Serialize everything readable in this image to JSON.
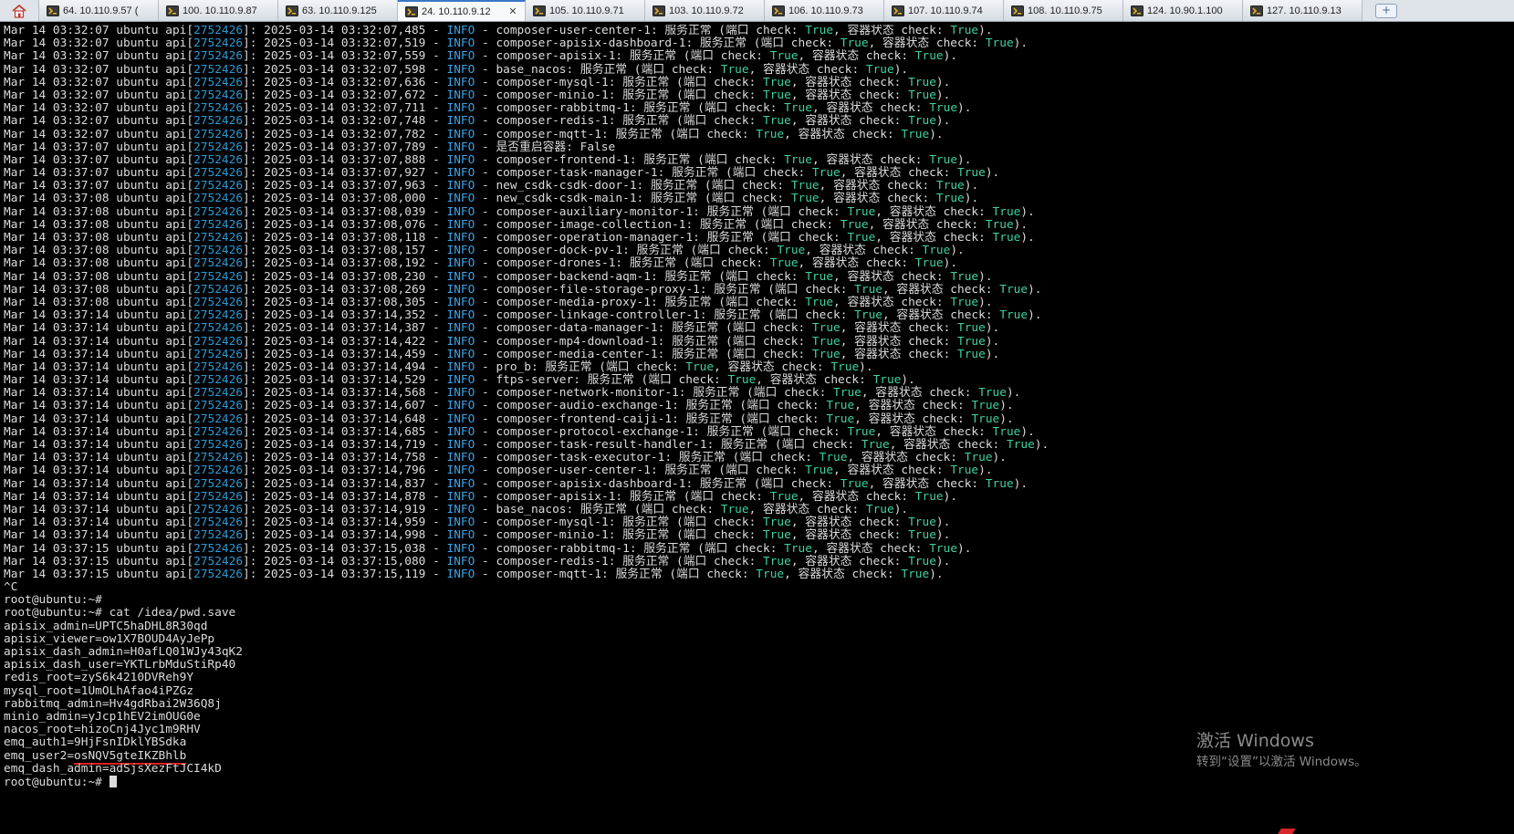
{
  "tabs": [
    {
      "label": "64. 10.110.9.57 (",
      "active": false
    },
    {
      "label": "100. 10.110.9.87",
      "active": false
    },
    {
      "label": "63. 10.110.9.125",
      "active": false
    },
    {
      "label": "24. 10.110.9.12",
      "active": true
    },
    {
      "label": "105. 10.110.9.71",
      "active": false
    },
    {
      "label": "103. 10.110.9.72",
      "active": false
    },
    {
      "label": "106. 10.110.9.73",
      "active": false
    },
    {
      "label": "107. 10.110.9.74",
      "active": false
    },
    {
      "label": "108. 10.110.9.75",
      "active": false
    },
    {
      "label": "124. 10.90.1.100",
      "active": false
    },
    {
      "label": "127. 10.110.9.13",
      "active": false
    }
  ],
  "log_lines": [
    {
      "ts": "Mar 14 03:32:07",
      "dt": "2025-03-14 03:32:07,485",
      "msg": "composer-user-center-1",
      "p": "True",
      "c": "True"
    },
    {
      "ts": "Mar 14 03:32:07",
      "dt": "2025-03-14 03:32:07,519",
      "msg": "composer-apisix-dashboard-1",
      "p": "True",
      "c": "True"
    },
    {
      "ts": "Mar 14 03:32:07",
      "dt": "2025-03-14 03:32:07,559",
      "msg": "composer-apisix-1",
      "p": "True",
      "c": "True"
    },
    {
      "ts": "Mar 14 03:32:07",
      "dt": "2025-03-14 03:32:07,598",
      "msg": "base_nacos",
      "p": "True",
      "c": "True"
    },
    {
      "ts": "Mar 14 03:32:07",
      "dt": "2025-03-14 03:32:07,636",
      "msg": "composer-mysql-1",
      "p": "True",
      "c": "True"
    },
    {
      "ts": "Mar 14 03:32:07",
      "dt": "2025-03-14 03:32:07,672",
      "msg": "composer-minio-1",
      "p": "True",
      "c": "True"
    },
    {
      "ts": "Mar 14 03:32:07",
      "dt": "2025-03-14 03:32:07,711",
      "msg": "composer-rabbitmq-1",
      "p": "True",
      "c": "True"
    },
    {
      "ts": "Mar 14 03:32:07",
      "dt": "2025-03-14 03:32:07,748",
      "msg": "composer-redis-1",
      "p": "True",
      "c": "True"
    },
    {
      "ts": "Mar 14 03:32:07",
      "dt": "2025-03-14 03:32:07,782",
      "msg": "composer-mqtt-1",
      "p": "True",
      "c": "True"
    },
    {
      "ts": "Mar 14 03:37:07",
      "dt": "2025-03-14 03:37:07,789",
      "msg": "是否重启容器: False",
      "p": "",
      "c": ""
    },
    {
      "ts": "Mar 14 03:37:07",
      "dt": "2025-03-14 03:37:07,888",
      "msg": "composer-frontend-1",
      "p": "True",
      "c": "True"
    },
    {
      "ts": "Mar 14 03:37:07",
      "dt": "2025-03-14 03:37:07,927",
      "msg": "composer-task-manager-1",
      "p": "True",
      "c": "True"
    },
    {
      "ts": "Mar 14 03:37:07",
      "dt": "2025-03-14 03:37:07,963",
      "msg": "new_csdk-csdk-door-1",
      "p": "True",
      "c": "True"
    },
    {
      "ts": "Mar 14 03:37:08",
      "dt": "2025-03-14 03:37:08,000",
      "msg": "new_csdk-csdk-main-1",
      "p": "True",
      "c": "True"
    },
    {
      "ts": "Mar 14 03:37:08",
      "dt": "2025-03-14 03:37:08,039",
      "msg": "composer-auxiliary-monitor-1",
      "p": "True",
      "c": "True"
    },
    {
      "ts": "Mar 14 03:37:08",
      "dt": "2025-03-14 03:37:08,076",
      "msg": "composer-image-collection-1",
      "p": "True",
      "c": "True"
    },
    {
      "ts": "Mar 14 03:37:08",
      "dt": "2025-03-14 03:37:08,118",
      "msg": "composer-operation-manager-1",
      "p": "True",
      "c": "True"
    },
    {
      "ts": "Mar 14 03:37:08",
      "dt": "2025-03-14 03:37:08,157",
      "msg": "composer-dock-pv-1",
      "p": "True",
      "c": "True"
    },
    {
      "ts": "Mar 14 03:37:08",
      "dt": "2025-03-14 03:37:08,192",
      "msg": "composer-drones-1",
      "p": "True",
      "c": "True"
    },
    {
      "ts": "Mar 14 03:37:08",
      "dt": "2025-03-14 03:37:08,230",
      "msg": "composer-backend-aqm-1",
      "p": "True",
      "c": "True"
    },
    {
      "ts": "Mar 14 03:37:08",
      "dt": "2025-03-14 03:37:08,269",
      "msg": "composer-file-storage-proxy-1",
      "p": "True",
      "c": "True"
    },
    {
      "ts": "Mar 14 03:37:08",
      "dt": "2025-03-14 03:37:08,305",
      "msg": "composer-media-proxy-1",
      "p": "True",
      "c": "True"
    },
    {
      "ts": "Mar 14 03:37:14",
      "dt": "2025-03-14 03:37:14,352",
      "msg": "composer-linkage-controller-1",
      "p": "True",
      "c": "True"
    },
    {
      "ts": "Mar 14 03:37:14",
      "dt": "2025-03-14 03:37:14,387",
      "msg": "composer-data-manager-1",
      "p": "True",
      "c": "True"
    },
    {
      "ts": "Mar 14 03:37:14",
      "dt": "2025-03-14 03:37:14,422",
      "msg": "composer-mp4-download-1",
      "p": "True",
      "c": "True"
    },
    {
      "ts": "Mar 14 03:37:14",
      "dt": "2025-03-14 03:37:14,459",
      "msg": "composer-media-center-1",
      "p": "True",
      "c": "True"
    },
    {
      "ts": "Mar 14 03:37:14",
      "dt": "2025-03-14 03:37:14,494",
      "msg": "pro_b",
      "p": "True",
      "c": "True"
    },
    {
      "ts": "Mar 14 03:37:14",
      "dt": "2025-03-14 03:37:14,529",
      "msg": "ftps-server",
      "p": "True",
      "c": "True"
    },
    {
      "ts": "Mar 14 03:37:14",
      "dt": "2025-03-14 03:37:14,568",
      "msg": "composer-network-monitor-1",
      "p": "True",
      "c": "True"
    },
    {
      "ts": "Mar 14 03:37:14",
      "dt": "2025-03-14 03:37:14,607",
      "msg": "composer-audio-exchange-1",
      "p": "True",
      "c": "True"
    },
    {
      "ts": "Mar 14 03:37:14",
      "dt": "2025-03-14 03:37:14,648",
      "msg": "composer-frontend-caiji-1",
      "p": "True",
      "c": "True"
    },
    {
      "ts": "Mar 14 03:37:14",
      "dt": "2025-03-14 03:37:14,685",
      "msg": "composer-protocol-exchange-1",
      "p": "True",
      "c": "True"
    },
    {
      "ts": "Mar 14 03:37:14",
      "dt": "2025-03-14 03:37:14,719",
      "msg": "composer-task-result-handler-1",
      "p": "True",
      "c": "True"
    },
    {
      "ts": "Mar 14 03:37:14",
      "dt": "2025-03-14 03:37:14,758",
      "msg": "composer-task-executor-1",
      "p": "True",
      "c": "True"
    },
    {
      "ts": "Mar 14 03:37:14",
      "dt": "2025-03-14 03:37:14,796",
      "msg": "composer-user-center-1",
      "p": "True",
      "c": "True"
    },
    {
      "ts": "Mar 14 03:37:14",
      "dt": "2025-03-14 03:37:14,837",
      "msg": "composer-apisix-dashboard-1",
      "p": "True",
      "c": "True"
    },
    {
      "ts": "Mar 14 03:37:14",
      "dt": "2025-03-14 03:37:14,878",
      "msg": "composer-apisix-1",
      "p": "True",
      "c": "True"
    },
    {
      "ts": "Mar 14 03:37:14",
      "dt": "2025-03-14 03:37:14,919",
      "msg": "base_nacos",
      "p": "True",
      "c": "True"
    },
    {
      "ts": "Mar 14 03:37:14",
      "dt": "2025-03-14 03:37:14,959",
      "msg": "composer-mysql-1",
      "p": "True",
      "c": "True"
    },
    {
      "ts": "Mar 14 03:37:14",
      "dt": "2025-03-14 03:37:14,998",
      "msg": "composer-minio-1",
      "p": "True",
      "c": "True"
    },
    {
      "ts": "Mar 14 03:37:15",
      "dt": "2025-03-14 03:37:15,038",
      "msg": "composer-rabbitmq-1",
      "p": "True",
      "c": "True"
    },
    {
      "ts": "Mar 14 03:37:15",
      "dt": "2025-03-14 03:37:15,080",
      "msg": "composer-redis-1",
      "p": "True",
      "c": "True"
    },
    {
      "ts": "Mar 14 03:37:15",
      "dt": "2025-03-14 03:37:15,119",
      "msg": "composer-mqtt-1",
      "p": "True",
      "c": "True"
    }
  ],
  "log_parts": {
    "host": "ubuntu",
    "proc": "api",
    "pid": "2752426",
    "level": "INFO",
    "status": "服务正常",
    "port_check": "端口 check",
    "container_check": "容器状态 check"
  },
  "shell_lines": [
    {
      "text": "^C",
      "kind": "plain"
    },
    {
      "text": "root@ubuntu:~#",
      "kind": "plain"
    },
    {
      "text": "root@ubuntu:~# cat /idea/pwd.save",
      "kind": "plain"
    },
    {
      "text": "apisix_admin=UPTC5haDHL8R30qd",
      "kind": "plain"
    },
    {
      "text": "apisix_viewer=ow1X7BOUD4AyJePp",
      "kind": "plain"
    },
    {
      "text": "apisix_dash_admin=H0afLQ01WJy43qK2",
      "kind": "plain"
    },
    {
      "text": "apisix_dash_user=YKTLrbMduStiRp40",
      "kind": "plain"
    },
    {
      "text": "redis_root=zyS6k4210DVReh9Y",
      "kind": "plain"
    },
    {
      "text": "mysql_root=1UmOLhAfao4iPZGz",
      "kind": "plain"
    },
    {
      "text": "rabbitmq_admin=Hv4gdRbai2W36Q8j",
      "kind": "plain"
    },
    {
      "text": "minio_admin=yJcp1hEV2imOUG0e",
      "kind": "plain"
    },
    {
      "text": "nacos_root=hizoCnj4Jyc1m9RHV",
      "kind": "plain"
    },
    {
      "text": "emq_auth1=9HjFsnIDklYBSdka",
      "kind": "plain"
    },
    {
      "text": "emq_user2=osNQV5gteIKZBhlb",
      "kind": "highlight"
    },
    {
      "text": "emq_dash_admin=adSjsXezFtJCI4kD",
      "kind": "plain"
    },
    {
      "text": "root@ubuntu:~#",
      "kind": "prompt"
    }
  ],
  "watermark": {
    "title": "激活 Windows",
    "subtitle": "转到“设置”以激活 Windows。"
  },
  "icons": {
    "home": "home-icon",
    "tab": "terminal-session-icon",
    "close": "close-icon",
    "new_tab": "new-tab-icon"
  },
  "colors": {
    "background": "#000000",
    "text": "#dcdcdc",
    "pid": "#2a9bd6",
    "info": "#3aa3e8",
    "true_value": "#40d0a0",
    "underline": "#e02020"
  }
}
